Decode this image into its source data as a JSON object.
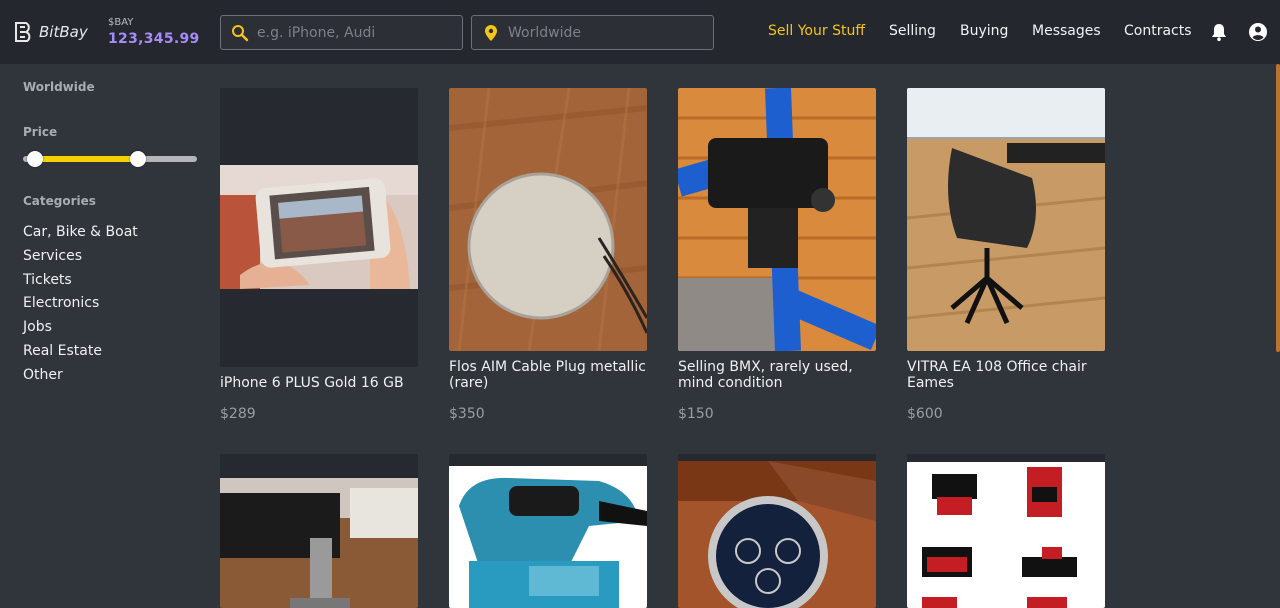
{
  "header": {
    "brand": "BitBay",
    "balance_label": "$BAY",
    "balance_value": "123,345.99",
    "search_placeholder": "e.g. iPhone, Audi",
    "location_placeholder": "Worldwide",
    "nav": {
      "sell": "Sell Your Stuff",
      "selling": "Selling",
      "buying": "Buying",
      "messages": "Messages",
      "contracts": "Contracts"
    },
    "icons": [
      "bell-icon",
      "account-icon"
    ]
  },
  "sidebar": {
    "location": "Worldwide",
    "price_heading": "Price",
    "price_range": {
      "low_fraction": 0.07,
      "high_fraction": 0.66
    },
    "categories_heading": "Categories",
    "categories": [
      "Car, Bike & Boat",
      "Services",
      "Tickets",
      "Electronics",
      "Jobs",
      "Real Estate",
      "Other"
    ]
  },
  "listings": [
    {
      "title": "iPhone 6 PLUS Gold 16 GB",
      "price": "$289"
    },
    {
      "title": "Flos AIM Cable Plug metallic (rare)",
      "price": "$350"
    },
    {
      "title": "Selling BMX, rarely used, mind condition",
      "price": "$150"
    },
    {
      "title": "VITRA EA 108 Office chair Eames",
      "price": "$600"
    },
    {
      "title": "",
      "price": ""
    },
    {
      "title": "",
      "price": ""
    },
    {
      "title": "",
      "price": ""
    },
    {
      "title": "",
      "price": ""
    }
  ],
  "colors": {
    "accent": "#f5c518",
    "balance": "#a78bfa",
    "header_bg": "#24272d",
    "page_bg": "#30343b"
  }
}
